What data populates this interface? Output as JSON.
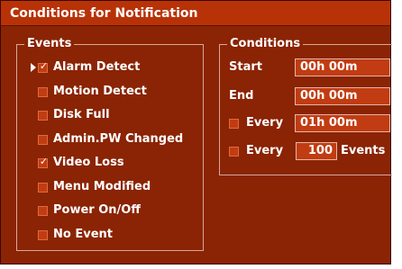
{
  "window": {
    "title": "Conditions for Notification"
  },
  "events": {
    "legend": "Events",
    "items": [
      {
        "label": "Alarm Detect",
        "checked": true,
        "selected": true
      },
      {
        "label": "Motion Detect",
        "checked": false,
        "selected": false
      },
      {
        "label": "Disk Full",
        "checked": false,
        "selected": false
      },
      {
        "label": "Admin.PW Changed",
        "checked": false,
        "selected": false
      },
      {
        "label": "Video Loss",
        "checked": true,
        "selected": false
      },
      {
        "label": "Menu Modified",
        "checked": false,
        "selected": false
      },
      {
        "label": "Power On/Off",
        "checked": false,
        "selected": false
      },
      {
        "label": "No Event",
        "checked": false,
        "selected": false
      }
    ]
  },
  "conditions": {
    "legend": "Conditions",
    "start_label": "Start",
    "start_value": "00h 00m",
    "end_label": "End",
    "end_value": "00h 00m",
    "every_time_label": "Every",
    "every_time_checked": false,
    "every_time_value": "01h 00m",
    "every_events_label": "Every",
    "every_events_checked": false,
    "every_events_value": "100",
    "every_events_suffix": "Events"
  },
  "colors": {
    "panel": "#8a2404",
    "title_bar": "#b83207",
    "field": "#c13c12",
    "text": "#ffffff"
  }
}
